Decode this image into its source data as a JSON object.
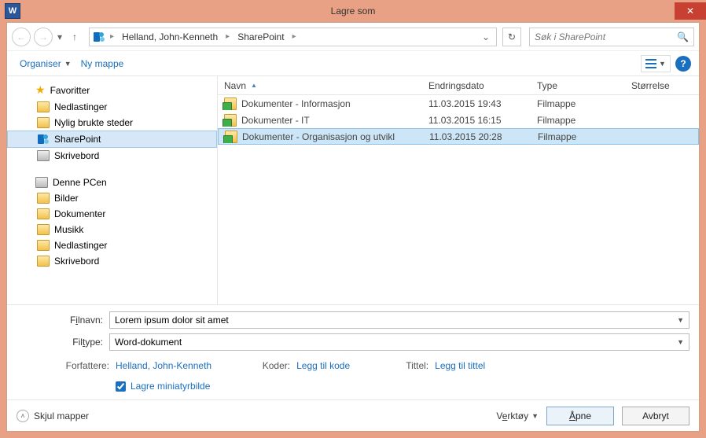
{
  "title": "Lagre som",
  "close_glyph": "✕",
  "nav": {
    "back": "←",
    "fwd": "→",
    "drop": "▾",
    "up": "↑"
  },
  "breadcrumb": {
    "user": "Helland, John-Kenneth",
    "loc": "SharePoint"
  },
  "refresh_glyph": "↻",
  "search": {
    "placeholder": "Søk i SharePoint",
    "icon": "🔍"
  },
  "toolbar": {
    "organiser": "Organiser",
    "ny_mappe": "Ny mappe",
    "help": "?"
  },
  "tree": {
    "fav_label": "Favoritter",
    "fav_items": [
      "Nedlastinger",
      "Nylig brukte steder",
      "SharePoint",
      "Skrivebord"
    ],
    "pc_label": "Denne PCen",
    "pc_items": [
      "Bilder",
      "Dokumenter",
      "Musikk",
      "Nedlastinger",
      "Skrivebord"
    ]
  },
  "columns": {
    "name": "Navn",
    "date": "Endringsdato",
    "type": "Type",
    "size": "Størrelse"
  },
  "rows": [
    {
      "name": "Dokumenter - Informasjon",
      "date": "11.03.2015 19:43",
      "type": "Filmappe"
    },
    {
      "name": "Dokumenter - IT",
      "date": "11.03.2015 16:15",
      "type": "Filmappe"
    },
    {
      "name": "Dokumenter - Organisasjon og utvikl",
      "date": "11.03.2015 20:28",
      "type": "Filmappe"
    }
  ],
  "form": {
    "filnavn_label_pre": "F",
    "filnavn_label_ul": "i",
    "filnavn_label_post": "lnavn:",
    "filnavn_value": "Lorem ipsum dolor sit amet",
    "filtype_label_pre": "Fil",
    "filtype_label_ul": "t",
    "filtype_label_post": "ype:",
    "filtype_value": "Word-dokument",
    "forfattere_label": "Forfattere:",
    "forfattere_value": "Helland, John-Kenneth",
    "koder_label": "Koder:",
    "koder_value": "Legg til kode",
    "tittel_label": "Tittel:",
    "tittel_value": "Legg til tittel",
    "thumb_label": "Lagre miniatyrbilde"
  },
  "footer": {
    "hide": "Skjul mapper",
    "tools_pre": "V",
    "tools_ul": "e",
    "tools_post": "rktøy",
    "open_pre": "",
    "open_ul": "Å",
    "open_post": "pne",
    "cancel": "Avbryt"
  }
}
